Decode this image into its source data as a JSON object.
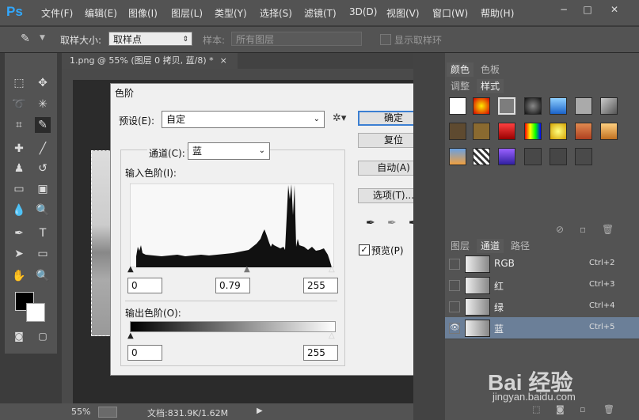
{
  "app": {
    "logo": "Ps"
  },
  "menu": [
    "文件(F)",
    "编辑(E)",
    "图像(I)",
    "图层(L)",
    "类型(Y)",
    "选择(S)",
    "滤镜(T)",
    "3D(D)",
    "视图(V)",
    "窗口(W)",
    "帮助(H)"
  ],
  "window_controls": {
    "minimize": "−",
    "restore": "□",
    "close": "✕"
  },
  "options": {
    "sample_size_label": "取样大小:",
    "sample_size_value": "取样点",
    "sample_label": "样本:",
    "sample_value": "所有图层",
    "show_ring_label": "显示取样环"
  },
  "document_tab": {
    "title": "1.png @ 55% (图层 0 拷贝, 蓝/8) *",
    "close": "×"
  },
  "status": {
    "zoom": "55%",
    "doc": "文档:831.9K/1.62M"
  },
  "dialog": {
    "title": "色阶",
    "preset_label": "预设(E):",
    "preset_value": "自定",
    "channel_label": "通道(C):",
    "channel_value": "蓝",
    "input_levels_label": "输入色阶(I):",
    "input_black": "0",
    "input_gamma": "0.79",
    "input_white": "255",
    "output_levels_label": "输出色阶(O):",
    "output_black": "0",
    "output_white": "255",
    "buttons": {
      "ok": "确定",
      "reset": "复位",
      "auto": "自动(A)",
      "options": "选项(T)..."
    },
    "preview_label": "预览(P)",
    "preview_checked": true,
    "close": "✕"
  },
  "panels": {
    "top_tabs": [
      "颜色",
      "色板"
    ],
    "style_tabs": [
      "调整",
      "样式"
    ],
    "layer_tabs": [
      "图层",
      "通道",
      "路径"
    ],
    "channels": [
      {
        "name": "RGB",
        "shortcut": "Ctrl+2",
        "visible": false,
        "selected": false
      },
      {
        "name": "红",
        "shortcut": "Ctrl+3",
        "visible": false,
        "selected": false
      },
      {
        "name": "绿",
        "shortcut": "Ctrl+4",
        "visible": false,
        "selected": false
      },
      {
        "name": "蓝",
        "shortcut": "Ctrl+5",
        "visible": true,
        "selected": true
      }
    ]
  },
  "colors": {
    "accent": "#31a8ff",
    "selected_row": "#6b7f98",
    "dialog_bg": "#f0f0f0"
  },
  "watermark": {
    "text": "Bai 经验",
    "url": "jingyan.baidu.com"
  }
}
